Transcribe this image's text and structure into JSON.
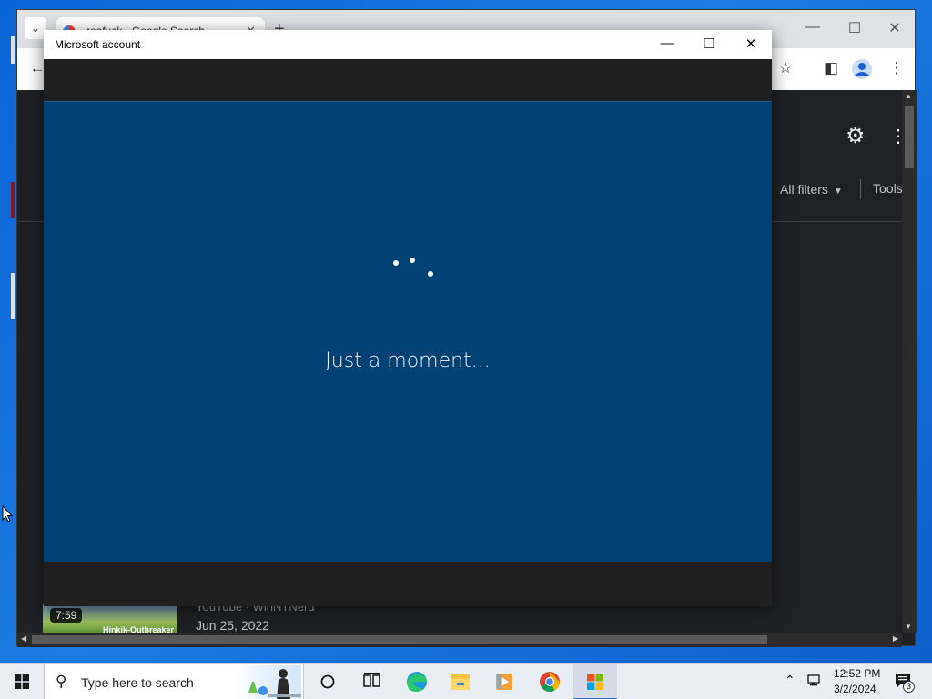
{
  "chrome": {
    "tab_title": "reafuck - Google Search",
    "tab_dropdown_icon": "chevron-down-icon",
    "new_tab_icon": "plus-icon",
    "window_controls": [
      "minimize-icon",
      "maximize-icon",
      "close-icon"
    ]
  },
  "google_page": {
    "filters_label": "All filters",
    "tools_label": "Tools",
    "video_duration": "7:59",
    "thumb_caption": "Hinkik-Outbreaker",
    "result_source": "YouTube · WinNTNerd",
    "result_date": "Jun 25, 2022"
  },
  "ms_dialog": {
    "title": "Microsoft account",
    "status_text": "Just a moment...",
    "colors": {
      "content": "#004275",
      "frame": "#202020"
    }
  },
  "taskbar": {
    "search_placeholder": "Type here to search",
    "apps": [
      "task-view-icon",
      "edge-icon",
      "file-explorer-icon",
      "media-player-icon",
      "chrome-icon",
      "store-icon"
    ],
    "time": "12:52 PM",
    "date": "3/2/2024",
    "notification_count": "3"
  }
}
